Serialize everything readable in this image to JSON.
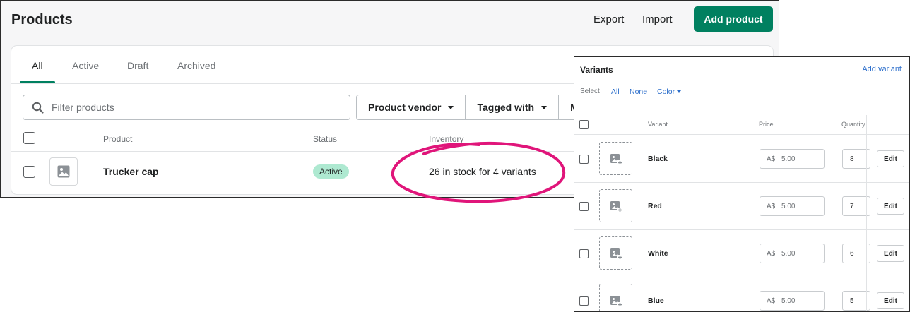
{
  "products_page": {
    "title": "Products",
    "export_label": "Export",
    "import_label": "Import",
    "add_product_label": "Add product",
    "tabs": [
      {
        "label": "All"
      },
      {
        "label": "Active"
      },
      {
        "label": "Draft"
      },
      {
        "label": "Archived"
      }
    ],
    "active_tab": "All",
    "search": {
      "placeholder": "Filter products",
      "value": ""
    },
    "filters": [
      {
        "label": "Product vendor"
      },
      {
        "label": "Tagged with"
      },
      {
        "label": "Mo"
      }
    ],
    "columns": {
      "product": "Product",
      "status": "Status",
      "inventory": "Inventory"
    },
    "rows": [
      {
        "name": "Trucker cap",
        "status": "Active",
        "inventory": "26 in stock for 4 variants"
      }
    ],
    "colors": {
      "primary": "#008060",
      "badge_active": "#aee9d1",
      "annotation": "#e0157a"
    }
  },
  "variants_panel": {
    "title": "Variants",
    "add_variant_label": "Add variant",
    "select_label": "Select",
    "select_all": "All",
    "select_none": "None",
    "select_color": "Color",
    "columns": {
      "variant": "Variant",
      "price": "Price",
      "quantity": "Quantity"
    },
    "edit_label": "Edit",
    "rows": [
      {
        "name": "Black",
        "currency": "A$",
        "price": "5.00",
        "quantity": "8"
      },
      {
        "name": "Red",
        "currency": "A$",
        "price": "5.00",
        "quantity": "7"
      },
      {
        "name": "White",
        "currency": "A$",
        "price": "5.00",
        "quantity": "6"
      },
      {
        "name": "Blue",
        "currency": "A$",
        "price": "5.00",
        "quantity": "5"
      }
    ],
    "link_color": "#2c6ecb"
  }
}
